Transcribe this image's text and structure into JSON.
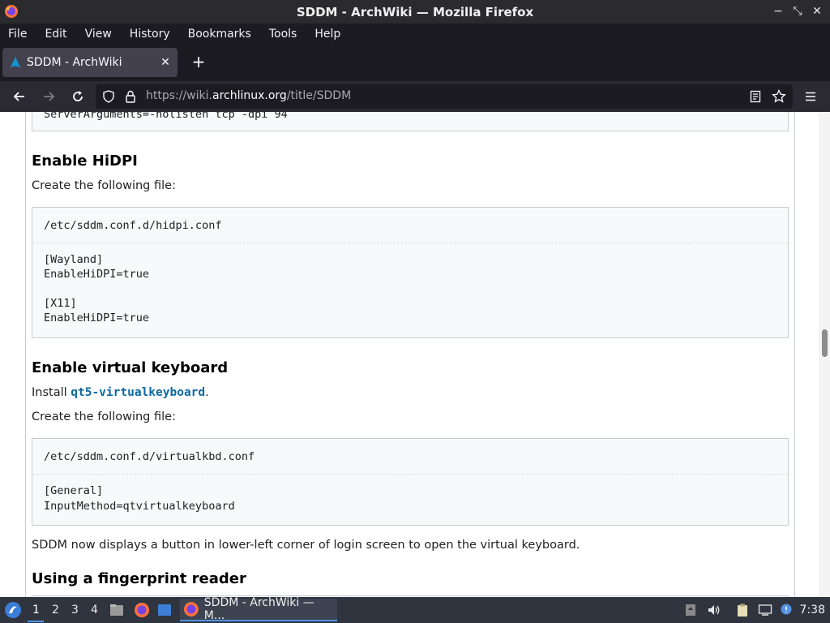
{
  "window": {
    "title": "SDDM - ArchWiki — Mozilla Firefox"
  },
  "menubar": {
    "items": [
      "File",
      "Edit",
      "View",
      "History",
      "Bookmarks",
      "Tools",
      "Help"
    ]
  },
  "tabs": [
    {
      "label": "SDDM - ArchWiki"
    }
  ],
  "urlbar": {
    "scheme_prefix": "https://wiki.",
    "host": "archlinux.org",
    "path": "/title/SDDM"
  },
  "content": {
    "partial_code_top": "ServerArguments=-nolisten tcp -dpi 94",
    "hidpi": {
      "heading": "Enable HiDPI",
      "intro": "Create the following file:",
      "filename": "/etc/sddm.conf.d/hidpi.conf",
      "lines": [
        "[Wayland]",
        "EnableHiDPI=true",
        "",
        "[X11]",
        "EnableHiDPI=true"
      ]
    },
    "vkbd": {
      "heading": "Enable virtual keyboard",
      "install_prefix": "Install ",
      "package": "qt5-virtualkeyboard",
      "install_suffix": ".",
      "intro": "Create the following file:",
      "filename": "/etc/sddm.conf.d/virtualkbd.conf",
      "lines": [
        "[General]",
        "InputMethod=qtvirtualkeyboard"
      ],
      "note": "SDDM now displays a button in lower-left corner of login screen to open the virtual keyboard."
    },
    "fingerprint": {
      "heading": "Using a fingerprint reader"
    }
  },
  "taskbar": {
    "workspaces": [
      "1",
      "2",
      "3",
      "4"
    ],
    "active_workspace": "1",
    "task_label": "SDDM - ArchWiki — M...",
    "clock": "7:38"
  },
  "colors": {
    "link": "#0b69a3",
    "accent": "#5294e2"
  }
}
